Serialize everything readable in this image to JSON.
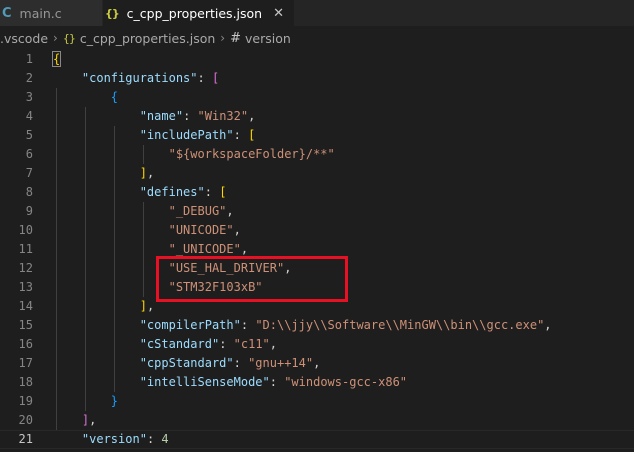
{
  "tabs": [
    {
      "icon": "C",
      "label": "main.c"
    },
    {
      "icon": "{}",
      "label": "c_cpp_properties.json",
      "close": "✕"
    }
  ],
  "breadcrumb": {
    "folder": ".vscode",
    "file_icon": "{}",
    "file": "c_cpp_properties.json",
    "symbol_icon": "#",
    "symbol": "version",
    "separator": "›"
  },
  "editor": {
    "active_line": 21,
    "lines": [
      {
        "num": "1",
        "tokens": [
          {
            "t": "{",
            "c": "b1 b1box"
          }
        ]
      },
      {
        "num": "2",
        "tokens": [
          {
            "t": "    "
          },
          {
            "t": "\"configurations\"",
            "c": "k"
          },
          {
            "t": ": ",
            "c": "p"
          },
          {
            "t": "[",
            "c": "b2"
          }
        ]
      },
      {
        "num": "3",
        "tokens": [
          {
            "t": "        "
          },
          {
            "t": "{",
            "c": "b3"
          }
        ]
      },
      {
        "num": "4",
        "tokens": [
          {
            "t": "            "
          },
          {
            "t": "\"name\"",
            "c": "k"
          },
          {
            "t": ": ",
            "c": "p"
          },
          {
            "t": "\"Win32\"",
            "c": "s"
          },
          {
            "t": ",",
            "c": "p"
          }
        ]
      },
      {
        "num": "5",
        "tokens": [
          {
            "t": "            "
          },
          {
            "t": "\"includePath\"",
            "c": "k"
          },
          {
            "t": ": ",
            "c": "p"
          },
          {
            "t": "[",
            "c": "b1"
          }
        ]
      },
      {
        "num": "6",
        "tokens": [
          {
            "t": "                "
          },
          {
            "t": "\"${workspaceFolder}/**\"",
            "c": "s"
          }
        ]
      },
      {
        "num": "7",
        "tokens": [
          {
            "t": "            "
          },
          {
            "t": "]",
            "c": "b1"
          },
          {
            "t": ",",
            "c": "p"
          }
        ]
      },
      {
        "num": "8",
        "tokens": [
          {
            "t": "            "
          },
          {
            "t": "\"defines\"",
            "c": "k"
          },
          {
            "t": ": ",
            "c": "p"
          },
          {
            "t": "[",
            "c": "b1"
          }
        ]
      },
      {
        "num": "9",
        "tokens": [
          {
            "t": "                "
          },
          {
            "t": "\"_DEBUG\"",
            "c": "s"
          },
          {
            "t": ",",
            "c": "p"
          }
        ]
      },
      {
        "num": "10",
        "tokens": [
          {
            "t": "                "
          },
          {
            "t": "\"UNICODE\"",
            "c": "s"
          },
          {
            "t": ",",
            "c": "p"
          }
        ]
      },
      {
        "num": "11",
        "tokens": [
          {
            "t": "                "
          },
          {
            "t": "\"_UNICODE\"",
            "c": "s"
          },
          {
            "t": ",",
            "c": "p"
          }
        ]
      },
      {
        "num": "12",
        "tokens": [
          {
            "t": "                "
          },
          {
            "t": "\"USE_HAL_DRIVER\"",
            "c": "s"
          },
          {
            "t": ",",
            "c": "p"
          }
        ]
      },
      {
        "num": "13",
        "tokens": [
          {
            "t": "                "
          },
          {
            "t": "\"STM32F103xB\"",
            "c": "s"
          }
        ]
      },
      {
        "num": "14",
        "tokens": [
          {
            "t": "            "
          },
          {
            "t": "]",
            "c": "b1"
          },
          {
            "t": ",",
            "c": "p"
          }
        ]
      },
      {
        "num": "15",
        "tokens": [
          {
            "t": "            "
          },
          {
            "t": "\"compilerPath\"",
            "c": "k"
          },
          {
            "t": ": ",
            "c": "p"
          },
          {
            "t": "\"D:\\\\jjy\\\\Software\\\\MinGW\\\\bin\\\\gcc.exe\"",
            "c": "s"
          },
          {
            "t": ",",
            "c": "p"
          }
        ]
      },
      {
        "num": "16",
        "tokens": [
          {
            "t": "            "
          },
          {
            "t": "\"cStandard\"",
            "c": "k"
          },
          {
            "t": ": ",
            "c": "p"
          },
          {
            "t": "\"c11\"",
            "c": "s"
          },
          {
            "t": ",",
            "c": "p"
          }
        ]
      },
      {
        "num": "17",
        "tokens": [
          {
            "t": "            "
          },
          {
            "t": "\"cppStandard\"",
            "c": "k"
          },
          {
            "t": ": ",
            "c": "p"
          },
          {
            "t": "\"gnu++14\"",
            "c": "s"
          },
          {
            "t": ",",
            "c": "p"
          }
        ]
      },
      {
        "num": "18",
        "tokens": [
          {
            "t": "            "
          },
          {
            "t": "\"intelliSenseMode\"",
            "c": "k"
          },
          {
            "t": ": ",
            "c": "p"
          },
          {
            "t": "\"windows-gcc-x86\"",
            "c": "s"
          }
        ]
      },
      {
        "num": "19",
        "tokens": [
          {
            "t": "        "
          },
          {
            "t": "}",
            "c": "b3"
          }
        ]
      },
      {
        "num": "20",
        "tokens": [
          {
            "t": "    "
          },
          {
            "t": "]",
            "c": "b2"
          },
          {
            "t": ",",
            "c": "p"
          }
        ]
      },
      {
        "num": "21",
        "tokens": [
          {
            "t": "    "
          },
          {
            "t": "\"version\"",
            "c": "k"
          },
          {
            "t": ": ",
            "c": "p"
          },
          {
            "t": "4",
            "c": "n"
          }
        ]
      }
    ]
  },
  "highlight_annotation": {
    "color": "#e81123",
    "lines": [
      "12",
      "13"
    ]
  }
}
